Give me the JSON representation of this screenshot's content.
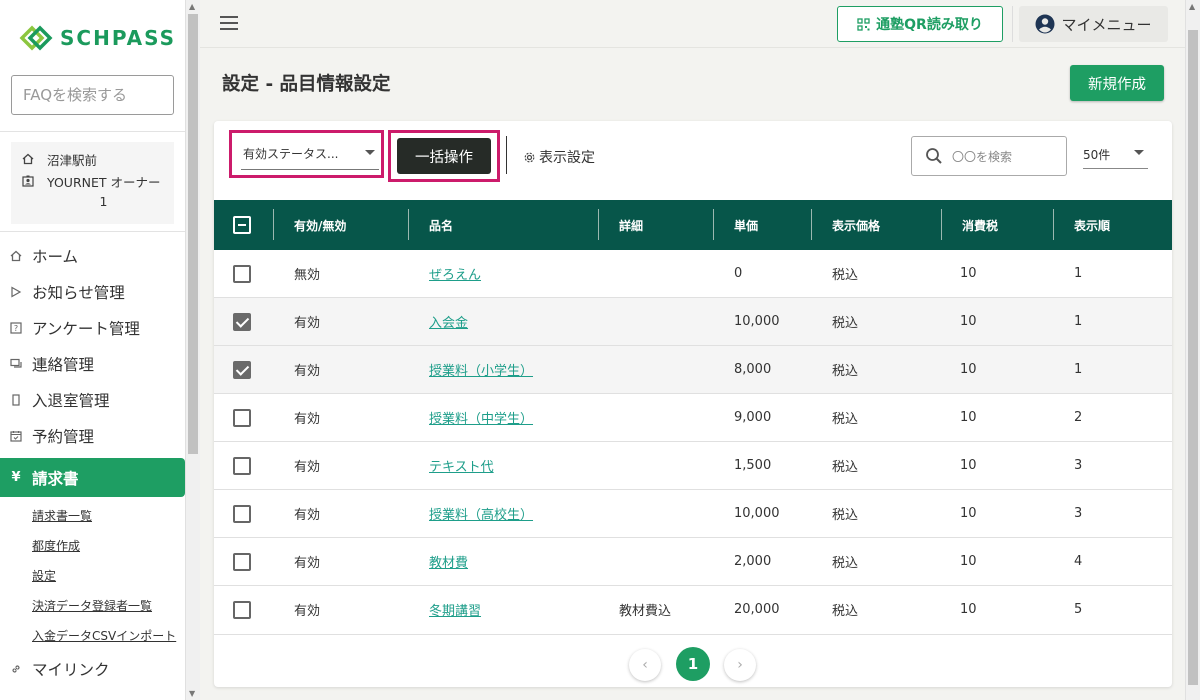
{
  "app": {
    "logo_text": "SCHPASS",
    "brand_color": "#1e9e63",
    "header_color": "#07564a",
    "highlight_color": "#cc1b6b"
  },
  "sidebar": {
    "faq_placeholder": "FAQを検索する",
    "school": "沼津駅前",
    "user": "YOURNET オーナー",
    "user_number": "1",
    "nav": [
      {
        "label": "ホーム",
        "icon": "home-icon"
      },
      {
        "label": "お知らせ管理",
        "icon": "play-icon"
      },
      {
        "label": "アンケート管理",
        "icon": "survey-icon"
      },
      {
        "label": "連絡管理",
        "icon": "chat-icon"
      },
      {
        "label": "入退室管理",
        "icon": "door-icon"
      },
      {
        "label": "予約管理",
        "icon": "calendar-icon"
      },
      {
        "label": "請求書",
        "icon": "yen-icon"
      }
    ],
    "sub_items": [
      "請求書一覧",
      "都度作成",
      "設定",
      "決済データ登録者一覧",
      "入金データCSVインポート"
    ],
    "after": {
      "label": "マイリンク",
      "icon": "link-icon"
    }
  },
  "header": {
    "qr_label": "通塾QR読み取り",
    "mymenu_label": "マイメニュー"
  },
  "main": {
    "title": "設定 - 品目情報設定",
    "new_button": "新規作成",
    "status_select": "有効ステータス...",
    "bulk_button": "一括操作",
    "display_settings": "表示設定",
    "search_placeholder": "〇〇を検索",
    "per_page": "50件"
  },
  "table": {
    "columns": [
      "有効/無効",
      "品名",
      "詳細",
      "単価",
      "表示価格",
      "消費税",
      "表示順"
    ],
    "rows": [
      {
        "checked": false,
        "status": "無効",
        "name": "ぜろえん",
        "detail": "",
        "price": "0",
        "display_price": "税込",
        "tax": "10",
        "order": "1"
      },
      {
        "checked": true,
        "status": "有効",
        "name": "入会金",
        "detail": "",
        "price": "10,000",
        "display_price": "税込",
        "tax": "10",
        "order": "1"
      },
      {
        "checked": true,
        "status": "有効",
        "name": "授業料（小学生）",
        "detail": "",
        "price": "8,000",
        "display_price": "税込",
        "tax": "10",
        "order": "1"
      },
      {
        "checked": false,
        "status": "有効",
        "name": "授業料（中学生）",
        "detail": "",
        "price": "9,000",
        "display_price": "税込",
        "tax": "10",
        "order": "2"
      },
      {
        "checked": false,
        "status": "有効",
        "name": "テキスト代",
        "detail": "",
        "price": "1,500",
        "display_price": "税込",
        "tax": "10",
        "order": "3"
      },
      {
        "checked": false,
        "status": "有効",
        "name": "授業料（高校生）",
        "detail": "",
        "price": "10,000",
        "display_price": "税込",
        "tax": "10",
        "order": "3"
      },
      {
        "checked": false,
        "status": "有効",
        "name": "教材費",
        "detail": "",
        "price": "2,000",
        "display_price": "税込",
        "tax": "10",
        "order": "4"
      },
      {
        "checked": false,
        "status": "有効",
        "name": "冬期講習",
        "detail": "教材費込",
        "price": "20,000",
        "display_price": "税込",
        "tax": "10",
        "order": "5"
      }
    ]
  },
  "pagination": {
    "current": "1",
    "prev": "‹",
    "next": "›"
  }
}
